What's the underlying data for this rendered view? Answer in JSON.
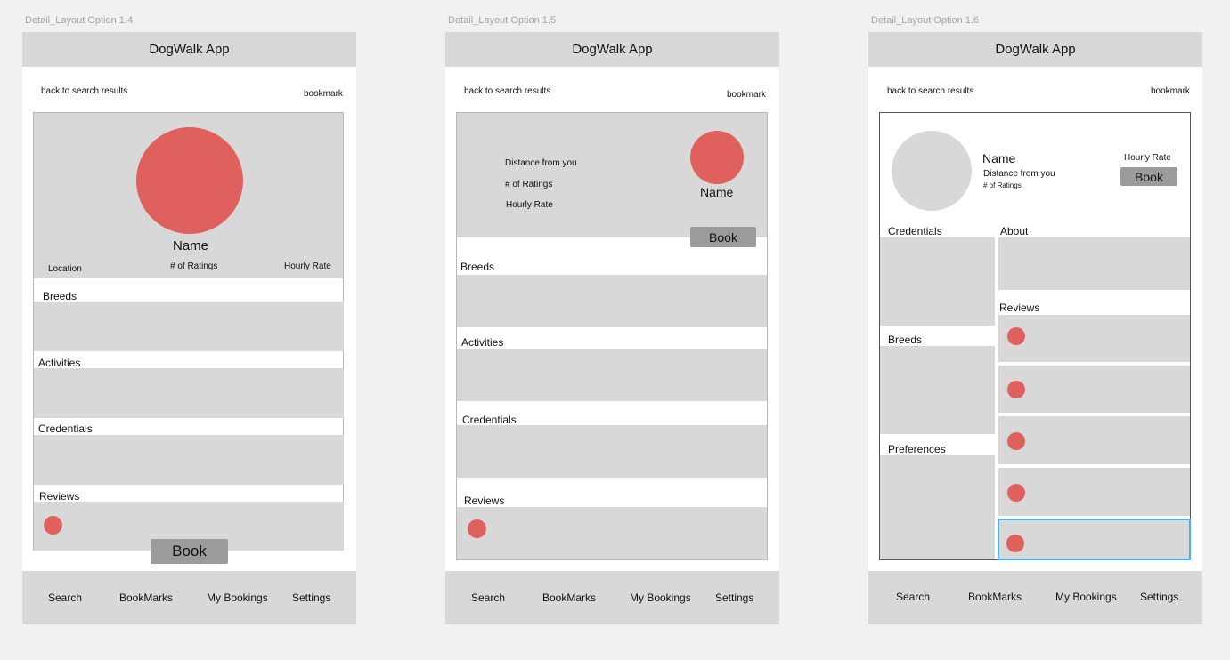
{
  "frames": [
    {
      "artboard_label": "Detail_Layout Option 1.4",
      "app_title": "DogWalk App",
      "back_link": "back to search results",
      "bookmark": "bookmark",
      "profile": {
        "name": "Name",
        "location": "Location",
        "ratings": "# of Ratings",
        "rate": "Hourly Rate"
      },
      "sections": {
        "breeds": "Breeds",
        "activities": "Activities",
        "credentials": "Credentials",
        "reviews": "Reviews"
      },
      "book": "Book",
      "tabs": [
        "Search",
        "BookMarks",
        "My Bookings",
        "Settings"
      ]
    },
    {
      "artboard_label": "Detail_Layout Option 1.5",
      "app_title": "DogWalk App",
      "back_link": "back to search results",
      "bookmark": "bookmark",
      "profile": {
        "name": "Name",
        "distance": "Distance from you",
        "ratings": "# of Ratings",
        "rate": "Hourly Rate"
      },
      "sections": {
        "breeds": "Breeds",
        "activities": "Activities",
        "credentials": "Credentials",
        "reviews": "Reviews"
      },
      "book": "Book",
      "tabs": [
        "Search",
        "BookMarks",
        "My Bookings",
        "Settings"
      ]
    },
    {
      "artboard_label": "Detail_Layout Option 1.6",
      "app_title": "DogWalk App",
      "back_link": "back to search results",
      "bookmark": "bookmark",
      "profile": {
        "name": "Name",
        "distance": "Distance from you",
        "ratings": "# of Ratings",
        "rate": "Hourly Rate"
      },
      "sections": {
        "credentials": "Credentials",
        "breeds": "Breeds",
        "preferences": "Preferences",
        "about": "About",
        "reviews": "Reviews"
      },
      "book": "Book",
      "tabs": [
        "Search",
        "BookMarks",
        "My Bookings",
        "Settings"
      ]
    }
  ],
  "colors": {
    "canvas": "#f1f1f1",
    "placeholder": "#d8d8d8",
    "avatar": "#e0605e",
    "button": "#9b9b9b",
    "selection": "#42b4ea"
  }
}
